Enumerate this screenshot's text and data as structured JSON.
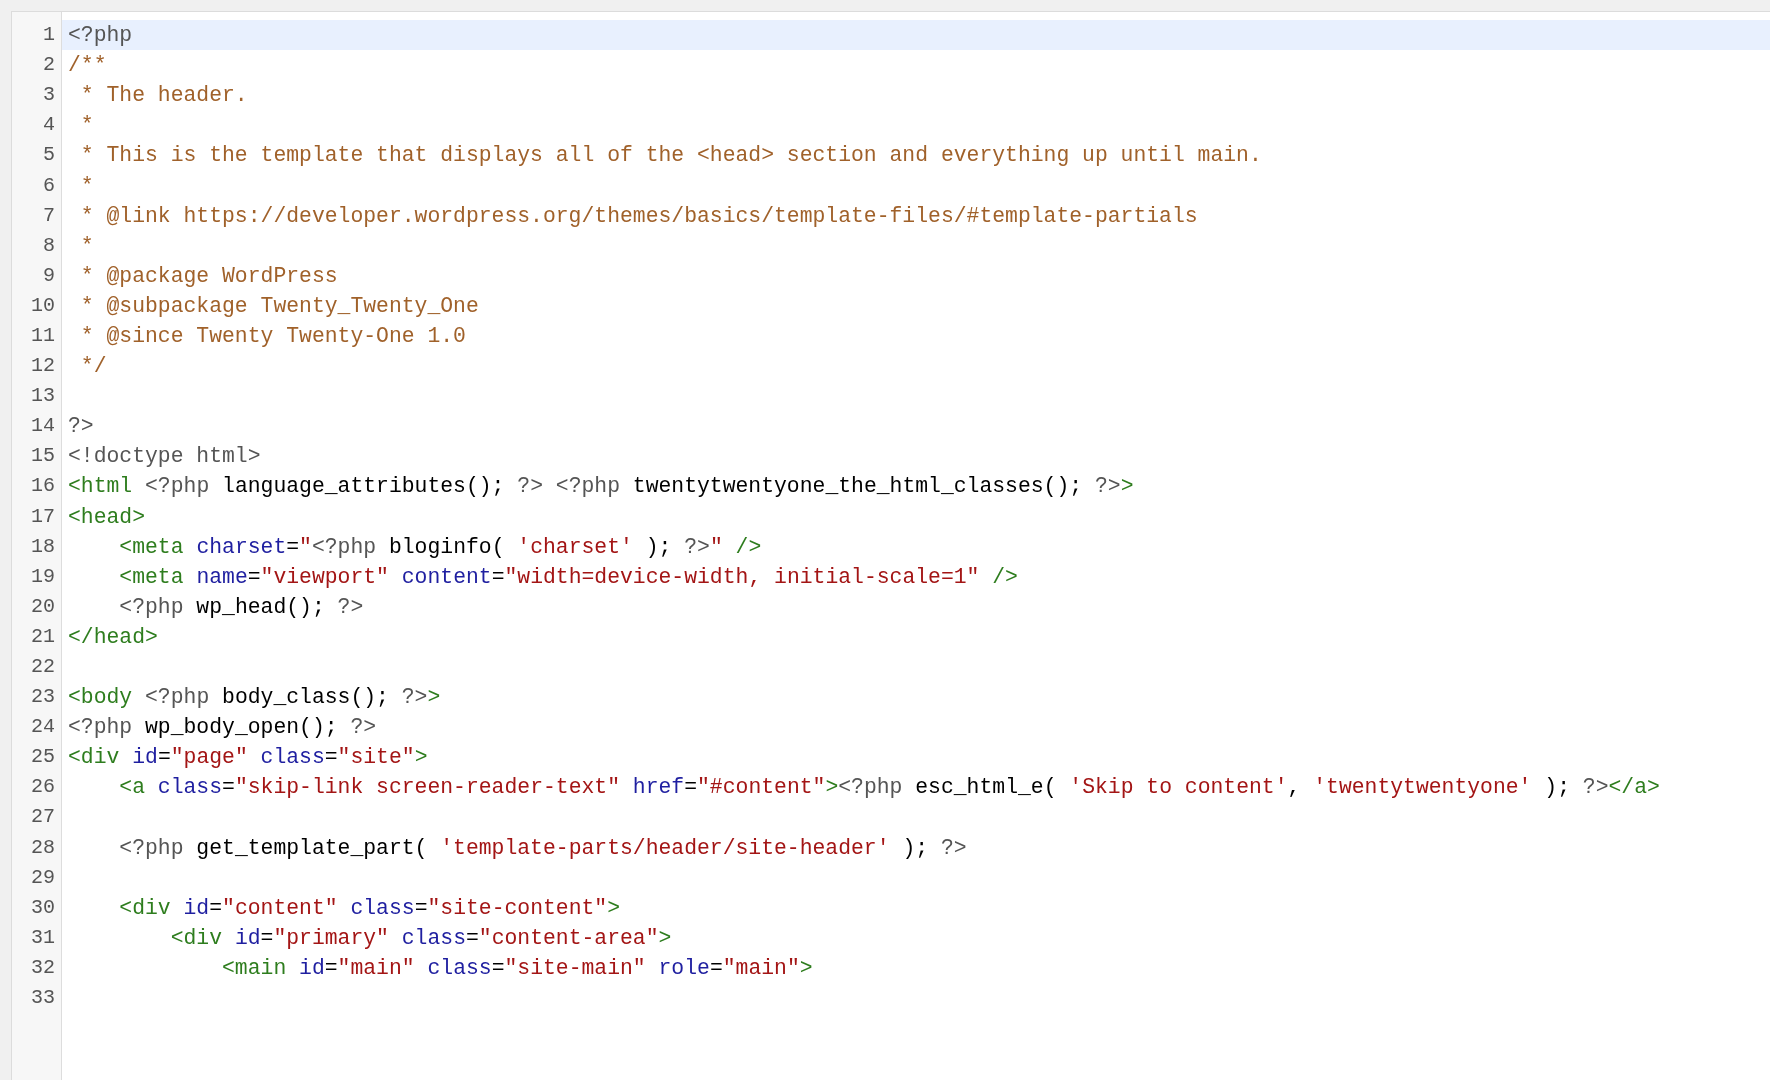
{
  "editor": {
    "lines": [
      {
        "number": "1",
        "selected": true,
        "tokens": [
          {
            "kind": "php",
            "text": "<?php"
          }
        ]
      },
      {
        "number": "2",
        "selected": false,
        "tokens": [
          {
            "kind": "comment",
            "text": "/**"
          }
        ]
      },
      {
        "number": "3",
        "selected": false,
        "tokens": [
          {
            "kind": "comment",
            "text": " * The header."
          }
        ]
      },
      {
        "number": "4",
        "selected": false,
        "tokens": [
          {
            "kind": "comment",
            "text": " *"
          }
        ]
      },
      {
        "number": "5",
        "selected": false,
        "tokens": [
          {
            "kind": "comment",
            "text": " * This is the template that displays all of the <head> section and everything up until main."
          }
        ]
      },
      {
        "number": "6",
        "selected": false,
        "tokens": [
          {
            "kind": "comment",
            "text": " *"
          }
        ]
      },
      {
        "number": "7",
        "selected": false,
        "tokens": [
          {
            "kind": "comment",
            "text": " * @link https://developer.wordpress.org/themes/basics/template-files/#template-partials"
          }
        ]
      },
      {
        "number": "8",
        "selected": false,
        "tokens": [
          {
            "kind": "comment",
            "text": " *"
          }
        ]
      },
      {
        "number": "9",
        "selected": false,
        "tokens": [
          {
            "kind": "comment",
            "text": " * @package WordPress"
          }
        ]
      },
      {
        "number": "10",
        "selected": false,
        "tokens": [
          {
            "kind": "comment",
            "text": " * @subpackage Twenty_Twenty_One"
          }
        ]
      },
      {
        "number": "11",
        "selected": false,
        "tokens": [
          {
            "kind": "comment",
            "text": " * @since Twenty Twenty-One 1.0"
          }
        ]
      },
      {
        "number": "12",
        "selected": false,
        "tokens": [
          {
            "kind": "comment",
            "text": " */"
          }
        ]
      },
      {
        "number": "13",
        "selected": false
      },
      {
        "number": "14",
        "selected": false,
        "tokens": [
          {
            "kind": "php",
            "text": "?>"
          }
        ]
      },
      {
        "number": "15",
        "selected": false,
        "tokens": [
          {
            "kind": "php",
            "text": "<!doctype html>"
          }
        ]
      },
      {
        "number": "16",
        "selected": false,
        "tokens": [
          {
            "kind": "tag",
            "text": "<html "
          },
          {
            "kind": "php",
            "text": "<?php"
          },
          {
            "kind": "plain",
            "text": " language_attributes(); "
          },
          {
            "kind": "php",
            "text": "?> <?php"
          },
          {
            "kind": "plain",
            "text": " twentytwentyone_the_html_classes(); "
          },
          {
            "kind": "php",
            "text": "?>"
          },
          {
            "kind": "tag",
            "text": ">"
          }
        ]
      },
      {
        "number": "17",
        "selected": false,
        "tokens": [
          {
            "kind": "tag",
            "text": "<head>"
          }
        ]
      },
      {
        "number": "18",
        "selected": false,
        "tokens": [
          {
            "kind": "tag",
            "text": "    <meta "
          },
          {
            "kind": "attr",
            "text": "charset"
          },
          {
            "kind": "plain",
            "text": "="
          },
          {
            "kind": "string",
            "text": "\""
          },
          {
            "kind": "php",
            "text": "<?php"
          },
          {
            "kind": "plain",
            "text": " bloginfo( "
          },
          {
            "kind": "string",
            "text": "'charset'"
          },
          {
            "kind": "plain",
            "text": " ); "
          },
          {
            "kind": "php",
            "text": "?>"
          },
          {
            "kind": "string",
            "text": "\" "
          },
          {
            "kind": "tag",
            "text": "/>"
          }
        ]
      },
      {
        "number": "19",
        "selected": false,
        "tokens": [
          {
            "kind": "tag",
            "text": "    <meta "
          },
          {
            "kind": "attr",
            "text": "name"
          },
          {
            "kind": "plain",
            "text": "="
          },
          {
            "kind": "string",
            "text": "\"viewport\" "
          },
          {
            "kind": "attr",
            "text": "content"
          },
          {
            "kind": "plain",
            "text": "="
          },
          {
            "kind": "string",
            "text": "\"width=device-width, initial-scale=1\" "
          },
          {
            "kind": "tag",
            "text": "/>"
          }
        ]
      },
      {
        "number": "20",
        "selected": false,
        "tokens": [
          {
            "kind": "php",
            "text": "    <?php"
          },
          {
            "kind": "plain",
            "text": " wp_head(); "
          },
          {
            "kind": "php",
            "text": "?>"
          }
        ]
      },
      {
        "number": "21",
        "selected": false,
        "tokens": [
          {
            "kind": "tag",
            "text": "</head>"
          }
        ]
      },
      {
        "number": "22",
        "selected": false
      },
      {
        "number": "23",
        "selected": false,
        "tokens": [
          {
            "kind": "tag",
            "text": "<body "
          },
          {
            "kind": "php",
            "text": "<?php"
          },
          {
            "kind": "plain",
            "text": " body_class(); "
          },
          {
            "kind": "php",
            "text": "?>"
          },
          {
            "kind": "tag",
            "text": ">"
          }
        ]
      },
      {
        "number": "24",
        "selected": false,
        "tokens": [
          {
            "kind": "php",
            "text": "<?php"
          },
          {
            "kind": "plain",
            "text": " wp_body_open(); "
          },
          {
            "kind": "php",
            "text": "?>"
          }
        ]
      },
      {
        "number": "25",
        "selected": false,
        "tokens": [
          {
            "kind": "tag",
            "text": "<div "
          },
          {
            "kind": "attr",
            "text": "id"
          },
          {
            "kind": "plain",
            "text": "="
          },
          {
            "kind": "string",
            "text": "\"page\" "
          },
          {
            "kind": "attr",
            "text": "class"
          },
          {
            "kind": "plain",
            "text": "="
          },
          {
            "kind": "string",
            "text": "\"site\""
          },
          {
            "kind": "tag",
            "text": ">"
          }
        ]
      },
      {
        "number": "26",
        "selected": false,
        "tokens": [
          {
            "kind": "tag",
            "text": "    <a "
          },
          {
            "kind": "attr",
            "text": "class"
          },
          {
            "kind": "plain",
            "text": "="
          },
          {
            "kind": "string",
            "text": "\"skip-link screen-reader-text\" "
          },
          {
            "kind": "attr",
            "text": "href"
          },
          {
            "kind": "plain",
            "text": "="
          },
          {
            "kind": "string",
            "text": "\"#content\""
          },
          {
            "kind": "tag",
            "text": ">"
          },
          {
            "kind": "php",
            "text": "<?php"
          },
          {
            "kind": "plain",
            "text": " esc_html_e( "
          },
          {
            "kind": "string",
            "text": "'Skip to content'"
          },
          {
            "kind": "plain",
            "text": ", "
          },
          {
            "kind": "string",
            "text": "'twentytwentyone'"
          },
          {
            "kind": "plain",
            "text": " ); "
          },
          {
            "kind": "php",
            "text": "?>"
          },
          {
            "kind": "tag",
            "text": "</a>"
          }
        ]
      },
      {
        "number": "27",
        "selected": false
      },
      {
        "number": "28",
        "selected": false,
        "tokens": [
          {
            "kind": "php",
            "text": "    <?php"
          },
          {
            "kind": "plain",
            "text": " get_template_part( "
          },
          {
            "kind": "string",
            "text": "'template-parts/header/site-header'"
          },
          {
            "kind": "plain",
            "text": " ); "
          },
          {
            "kind": "php",
            "text": "?>"
          }
        ]
      },
      {
        "number": "29",
        "selected": false
      },
      {
        "number": "30",
        "selected": false,
        "tokens": [
          {
            "kind": "tag",
            "text": "    <div "
          },
          {
            "kind": "attr",
            "text": "id"
          },
          {
            "kind": "plain",
            "text": "="
          },
          {
            "kind": "string",
            "text": "\"content\" "
          },
          {
            "kind": "attr",
            "text": "class"
          },
          {
            "kind": "plain",
            "text": "="
          },
          {
            "kind": "string",
            "text": "\"site-content\""
          },
          {
            "kind": "tag",
            "text": ">"
          }
        ]
      },
      {
        "number": "31",
        "selected": false,
        "tokens": [
          {
            "kind": "tag",
            "text": "        <div "
          },
          {
            "kind": "attr",
            "text": "id"
          },
          {
            "kind": "plain",
            "text": "="
          },
          {
            "kind": "string",
            "text": "\"primary\" "
          },
          {
            "kind": "attr",
            "text": "class"
          },
          {
            "kind": "plain",
            "text": "="
          },
          {
            "kind": "string",
            "text": "\"content-area\""
          },
          {
            "kind": "tag",
            "text": ">"
          }
        ]
      },
      {
        "number": "32",
        "selected": false,
        "tokens": [
          {
            "kind": "tag",
            "text": "            <main "
          },
          {
            "kind": "attr",
            "text": "id"
          },
          {
            "kind": "plain",
            "text": "="
          },
          {
            "kind": "string",
            "text": "\"main\" "
          },
          {
            "kind": "attr",
            "text": "class"
          },
          {
            "kind": "plain",
            "text": "="
          },
          {
            "kind": "string",
            "text": "\"site-main\" "
          },
          {
            "kind": "attr",
            "text": "role"
          },
          {
            "kind": "plain",
            "text": "="
          },
          {
            "kind": "string",
            "text": "\"main\""
          },
          {
            "kind": "tag",
            "text": ">"
          }
        ]
      },
      {
        "number": "33",
        "selected": false
      }
    ]
  }
}
